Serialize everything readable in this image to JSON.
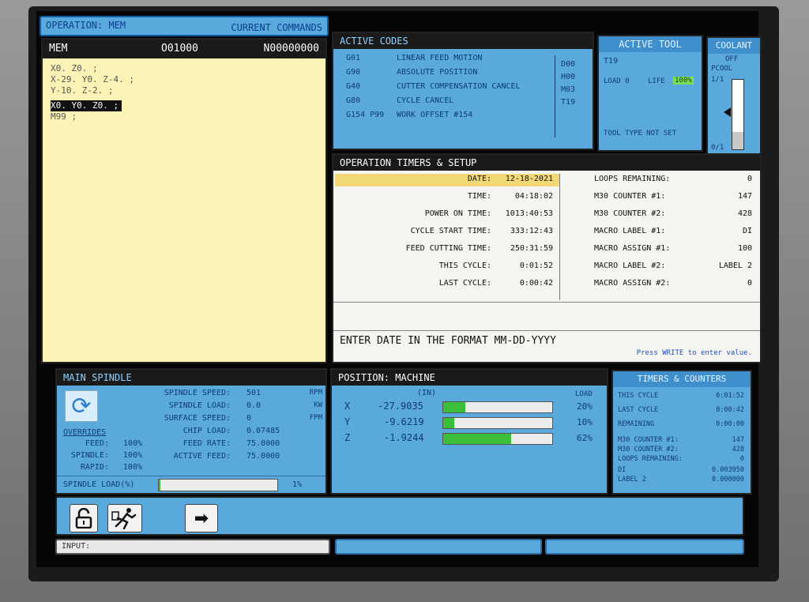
{
  "header": {
    "operation_label": "OPERATION: MEM",
    "current_commands": "CURRENT COMMANDS"
  },
  "program": {
    "mode": "MEM",
    "program_number": "O01000",
    "sequence_number": "N00000000",
    "lines": [
      "X0. Z0. ;",
      "X-29. Y0. Z-4. ;",
      "Y-10. Z-2. ;",
      "X0. Y0. Z0. ;",
      "M99 ;"
    ],
    "highlighted_line_index": 3
  },
  "active_codes": {
    "title": "ACTIVE CODES",
    "rows": [
      {
        "code": "G01",
        "desc": "LINEAR FEED MOTION"
      },
      {
        "code": "G90",
        "desc": "ABSOLUTE POSITION"
      },
      {
        "code": "G40",
        "desc": "CUTTER COMPENSATION CANCEL"
      },
      {
        "code": "G80",
        "desc": "CYCLE CANCEL"
      },
      {
        "code": "G154 P99",
        "desc": "WORK OFFSET #154"
      }
    ],
    "right_codes": [
      "D00",
      "H00",
      "M03",
      "T19"
    ]
  },
  "active_tool": {
    "title": "ACTIVE TOOL",
    "tool": "T19",
    "load_label": "LOAD 0",
    "life_label": "LIFE",
    "life_value": "100%",
    "tool_type": "TOOL TYPE NOT SET"
  },
  "coolant": {
    "title": "COOLANT",
    "state": "OFF",
    "pcool": "PCOOL",
    "top_value": "1/1",
    "bottom_value": "0/1",
    "level_fraction": 0.25
  },
  "timers": {
    "title": "OPERATION TIMERS & SETUP",
    "left": [
      {
        "label": "DATE:",
        "value": "12-18-2021"
      },
      {
        "label": "TIME:",
        "value": "04:18:02"
      },
      {
        "label": "POWER ON TIME:",
        "value": "1013:40:53"
      },
      {
        "label": "CYCLE START TIME:",
        "value": "333:12:43"
      },
      {
        "label": "FEED CUTTING TIME:",
        "value": "250:31:59"
      },
      {
        "label": "THIS CYCLE:",
        "value": "0:01:52"
      },
      {
        "label": "LAST CYCLE:",
        "value": "0:00:42"
      }
    ],
    "right": [
      {
        "label": "LOOPS REMAINING:",
        "value": "0"
      },
      {
        "label": "M30 COUNTER #1:",
        "value": "147"
      },
      {
        "label": "M30 COUNTER #2:",
        "value": "428"
      },
      {
        "label": "MACRO LABEL #1:",
        "value": "DI"
      },
      {
        "label": "MACRO ASSIGN #1:",
        "value": "100"
      },
      {
        "label": "MACRO LABEL #2:",
        "value": "LABEL 2"
      },
      {
        "label": "MACRO ASSIGN #2:",
        "value": "0"
      }
    ],
    "prompt": "ENTER DATE IN THE FORMAT MM-DD-YYYY",
    "hint": "Press WRITE to enter value."
  },
  "spindle": {
    "title": "MAIN SPINDLE",
    "rows": [
      {
        "label": "SPINDLE SPEED:",
        "value": "501",
        "unit": "RPM"
      },
      {
        "label": "SPINDLE LOAD:",
        "value": "0.0",
        "unit": "KW"
      },
      {
        "label": "SURFACE SPEED:",
        "value": "0",
        "unit": "FPM"
      },
      {
        "label": "CHIP LOAD:",
        "value": "0.07485",
        "unit": ""
      },
      {
        "label": "FEED RATE:",
        "value": "75.0000",
        "unit": ""
      },
      {
        "label": "ACTIVE FEED:",
        "value": "75.0000",
        "unit": ""
      }
    ],
    "overrides_label": "OVERRIDES",
    "overrides": [
      {
        "label": "FEED:",
        "value": "100%"
      },
      {
        "label": "SPINDLE:",
        "value": "100%"
      },
      {
        "label": "RAPID:",
        "value": "100%"
      }
    ],
    "load_label": "SPINDLE LOAD(%)",
    "load_value": "1%",
    "load_fraction": 0.01
  },
  "position": {
    "title": "POSITION: MACHINE",
    "units": "(IN)",
    "load_header": "LOAD",
    "axes": [
      {
        "axis": "X",
        "value": "-27.9035",
        "load": "20%",
        "fraction": 0.2
      },
      {
        "axis": "Y",
        "value": "-9.6219",
        "load": "10%",
        "fraction": 0.1
      },
      {
        "axis": "Z",
        "value": "-1.9244",
        "load": "62%",
        "fraction": 0.62
      }
    ]
  },
  "timers_counters": {
    "title": "TIMERS & COUNTERS",
    "rows": [
      {
        "label": "THIS CYCLE",
        "value": "0:01:52"
      },
      {
        "label": "LAST CYCLE",
        "value": "0:00:42"
      },
      {
        "label": "REMAINING",
        "value": "0:00:00"
      },
      {
        "label": "M30 COUNTER #1:",
        "value": "147"
      },
      {
        "label": "M30 COUNTER #2:",
        "value": "428"
      },
      {
        "label": "LOOPS REMAINING:",
        "value": "0"
      },
      {
        "label": "DI",
        "value": "0.003950"
      },
      {
        "label": "LABEL 2",
        "value": "0.000000"
      }
    ]
  },
  "input": {
    "label": "INPUT:"
  },
  "icons": {
    "lock": "unlock-icon",
    "runner": "running-man-icon",
    "arrow": "right-arrow-icon",
    "spindle": "refresh-icon"
  },
  "colors": {
    "panel_blue": "#5aa9dc",
    "program_bg": "#fbf3b5",
    "load_green": "#3bbf3b",
    "date_highlight": "#f3d878"
  }
}
